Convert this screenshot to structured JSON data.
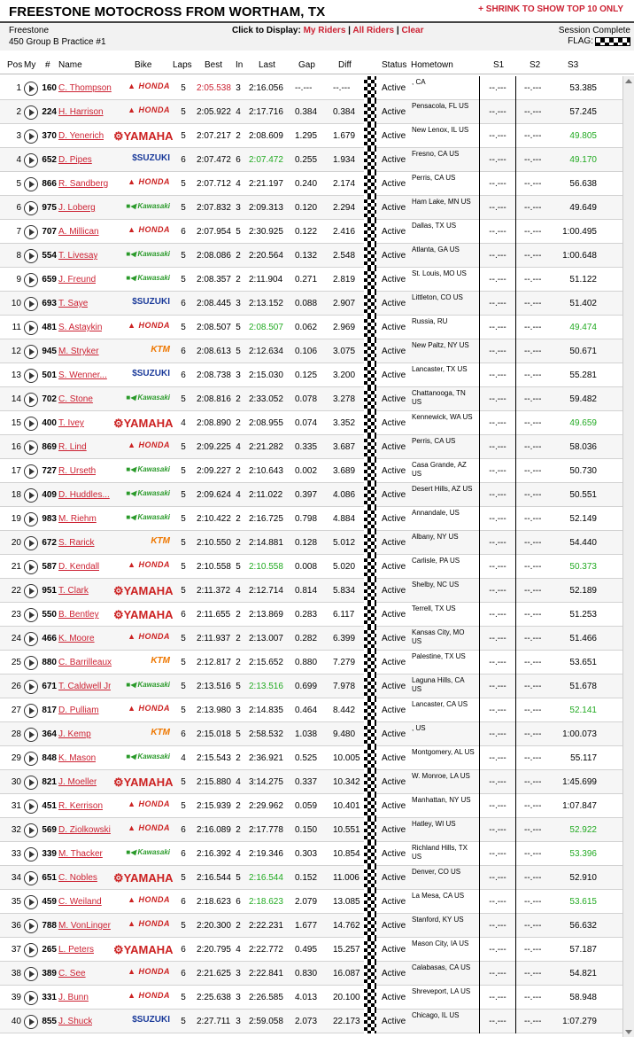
{
  "header": {
    "title": "FREESTONE MOTOCROSS FROM WORTHAM, TX",
    "shrink_link": "+ SHRINK TO SHOW TOP 10 ONLY",
    "track": "Freestone",
    "session": "450 Group B Practice #1",
    "display_label": "Click to Display:",
    "my_riders": "My Riders",
    "all_riders": "All Riders",
    "clear": "Clear",
    "sep": "|",
    "status": "Session Complete",
    "flag_label": "FLAG:"
  },
  "columns": {
    "pos": "Pos",
    "my": "My",
    "num": "#",
    "name": "Name",
    "bike": "Bike",
    "laps": "Laps",
    "best": "Best",
    "in": "In",
    "last": "Last",
    "gap": "Gap",
    "diff": "Diff",
    "status": "Status",
    "hometown": "Hometown",
    "s1": "S1",
    "s2": "S2",
    "s3": "S3"
  },
  "bike_labels": {
    "honda": "HONDA",
    "yamaha": "YAMAHA",
    "suzuki": "SUZUKI",
    "kawasaki": "Kawasaki",
    "ktm": "KTM"
  },
  "colors": {
    "accent_red": "#cc2233",
    "best_green": "#22aa22"
  },
  "riders": [
    {
      "pos": "1",
      "num": "160",
      "name": "C. Thompson",
      "bike": "honda",
      "laps": "5",
      "best": "2:05.538",
      "best_overall": true,
      "in": "3",
      "last": "2:16.056",
      "last_is_best": false,
      "gap": "--.---",
      "diff": "--.---",
      "status": "Active",
      "hometown": ", CA",
      "s1": "--.---",
      "s2": "--.---",
      "s3": "53.385",
      "s3_best": false
    },
    {
      "pos": "2",
      "num": "224",
      "name": "H. Harrison",
      "bike": "honda",
      "laps": "5",
      "best": "2:05.922",
      "best_overall": false,
      "in": "4",
      "last": "2:17.716",
      "last_is_best": false,
      "gap": "0.384",
      "diff": "0.384",
      "status": "Active",
      "hometown": "Pensacola, FL US",
      "s1": "--.---",
      "s2": "--.---",
      "s3": "57.245",
      "s3_best": false
    },
    {
      "pos": "3",
      "num": "370",
      "name": "D. Yenerich",
      "bike": "yamaha",
      "laps": "5",
      "best": "2:07.217",
      "best_overall": false,
      "in": "2",
      "last": "2:08.609",
      "last_is_best": false,
      "gap": "1.295",
      "diff": "1.679",
      "status": "Active",
      "hometown": "New Lenox, IL US",
      "s1": "--.---",
      "s2": "--.---",
      "s3": "49.805",
      "s3_best": true
    },
    {
      "pos": "4",
      "num": "652",
      "name": "D. Pipes",
      "bike": "suzuki",
      "laps": "6",
      "best": "2:07.472",
      "best_overall": false,
      "in": "6",
      "last": "2:07.472",
      "last_is_best": true,
      "gap": "0.255",
      "diff": "1.934",
      "status": "Active",
      "hometown": "Fresno, CA US",
      "s1": "--.---",
      "s2": "--.---",
      "s3": "49.170",
      "s3_best": true
    },
    {
      "pos": "5",
      "num": "866",
      "name": "R. Sandberg",
      "bike": "honda",
      "laps": "5",
      "best": "2:07.712",
      "best_overall": false,
      "in": "4",
      "last": "2:21.197",
      "last_is_best": false,
      "gap": "0.240",
      "diff": "2.174",
      "status": "Active",
      "hometown": "Perris, CA US",
      "s1": "--.---",
      "s2": "--.---",
      "s3": "56.638",
      "s3_best": false
    },
    {
      "pos": "6",
      "num": "975",
      "name": "J. Loberg",
      "bike": "kawasaki",
      "laps": "5",
      "best": "2:07.832",
      "best_overall": false,
      "in": "3",
      "last": "2:09.313",
      "last_is_best": false,
      "gap": "0.120",
      "diff": "2.294",
      "status": "Active",
      "hometown": "Ham Lake, MN US",
      "s1": "--.---",
      "s2": "--.---",
      "s3": "49.649",
      "s3_best": false
    },
    {
      "pos": "7",
      "num": "707",
      "name": "A. Millican",
      "bike": "honda",
      "laps": "6",
      "best": "2:07.954",
      "best_overall": false,
      "in": "5",
      "last": "2:30.925",
      "last_is_best": false,
      "gap": "0.122",
      "diff": "2.416",
      "status": "Active",
      "hometown": "Dallas, TX US",
      "s1": "--.---",
      "s2": "--.---",
      "s3": "1:00.495",
      "s3_best": false
    },
    {
      "pos": "8",
      "num": "554",
      "name": "T. Livesay",
      "bike": "kawasaki",
      "laps": "5",
      "best": "2:08.086",
      "best_overall": false,
      "in": "2",
      "last": "2:20.564",
      "last_is_best": false,
      "gap": "0.132",
      "diff": "2.548",
      "status": "Active",
      "hometown": "Atlanta, GA US",
      "s1": "--.---",
      "s2": "--.---",
      "s3": "1:00.648",
      "s3_best": false
    },
    {
      "pos": "9",
      "num": "659",
      "name": "J. Freund",
      "bike": "kawasaki",
      "laps": "5",
      "best": "2:08.357",
      "best_overall": false,
      "in": "2",
      "last": "2:11.904",
      "last_is_best": false,
      "gap": "0.271",
      "diff": "2.819",
      "status": "Active",
      "hometown": "St. Louis, MO US",
      "s1": "--.---",
      "s2": "--.---",
      "s3": "51.122",
      "s3_best": false
    },
    {
      "pos": "10",
      "num": "693",
      "name": "T. Saye",
      "bike": "suzuki",
      "laps": "6",
      "best": "2:08.445",
      "best_overall": false,
      "in": "3",
      "last": "2:13.152",
      "last_is_best": false,
      "gap": "0.088",
      "diff": "2.907",
      "status": "Active",
      "hometown": "Littleton, CO US",
      "s1": "--.---",
      "s2": "--.---",
      "s3": "51.402",
      "s3_best": false
    },
    {
      "pos": "11",
      "num": "481",
      "name": "S. Astaykin",
      "bike": "honda",
      "laps": "5",
      "best": "2:08.507",
      "best_overall": false,
      "in": "5",
      "last": "2:08.507",
      "last_is_best": true,
      "gap": "0.062",
      "diff": "2.969",
      "status": "Active",
      "hometown": "Russia, RU",
      "s1": "--.---",
      "s2": "--.---",
      "s3": "49.474",
      "s3_best": true
    },
    {
      "pos": "12",
      "num": "945",
      "name": "M. Stryker",
      "bike": "ktm",
      "laps": "6",
      "best": "2:08.613",
      "best_overall": false,
      "in": "5",
      "last": "2:12.634",
      "last_is_best": false,
      "gap": "0.106",
      "diff": "3.075",
      "status": "Active",
      "hometown": "New Paltz, NY US",
      "s1": "--.---",
      "s2": "--.---",
      "s3": "50.671",
      "s3_best": false
    },
    {
      "pos": "13",
      "num": "501",
      "name": "S. Wenner...",
      "bike": "suzuki",
      "laps": "6",
      "best": "2:08.738",
      "best_overall": false,
      "in": "3",
      "last": "2:15.030",
      "last_is_best": false,
      "gap": "0.125",
      "diff": "3.200",
      "status": "Active",
      "hometown": "Lancaster, TX US",
      "s1": "--.---",
      "s2": "--.---",
      "s3": "55.281",
      "s3_best": false
    },
    {
      "pos": "14",
      "num": "702",
      "name": "C. Stone",
      "bike": "kawasaki",
      "laps": "5",
      "best": "2:08.816",
      "best_overall": false,
      "in": "2",
      "last": "2:33.052",
      "last_is_best": false,
      "gap": "0.078",
      "diff": "3.278",
      "status": "Active",
      "hometown": "Chattanooga, TN US",
      "s1": "--.---",
      "s2": "--.---",
      "s3": "59.482",
      "s3_best": false
    },
    {
      "pos": "15",
      "num": "400",
      "name": "T. Ivey",
      "bike": "yamaha",
      "laps": "4",
      "best": "2:08.890",
      "best_overall": false,
      "in": "2",
      "last": "2:08.955",
      "last_is_best": false,
      "gap": "0.074",
      "diff": "3.352",
      "status": "Active",
      "hometown": "Kennewick, WA US",
      "s1": "--.---",
      "s2": "--.---",
      "s3": "49.659",
      "s3_best": true
    },
    {
      "pos": "16",
      "num": "869",
      "name": "R. Lind",
      "bike": "honda",
      "laps": "5",
      "best": "2:09.225",
      "best_overall": false,
      "in": "4",
      "last": "2:21.282",
      "last_is_best": false,
      "gap": "0.335",
      "diff": "3.687",
      "status": "Active",
      "hometown": "Perris, CA US",
      "s1": "--.---",
      "s2": "--.---",
      "s3": "58.036",
      "s3_best": false
    },
    {
      "pos": "17",
      "num": "727",
      "name": "R. Urseth",
      "bike": "kawasaki",
      "laps": "5",
      "best": "2:09.227",
      "best_overall": false,
      "in": "2",
      "last": "2:10.643",
      "last_is_best": false,
      "gap": "0.002",
      "diff": "3.689",
      "status": "Active",
      "hometown": "Casa Grande, AZ US",
      "s1": "--.---",
      "s2": "--.---",
      "s3": "50.730",
      "s3_best": false
    },
    {
      "pos": "18",
      "num": "409",
      "name": "D. Huddles...",
      "bike": "kawasaki",
      "laps": "5",
      "best": "2:09.624",
      "best_overall": false,
      "in": "4",
      "last": "2:11.022",
      "last_is_best": false,
      "gap": "0.397",
      "diff": "4.086",
      "status": "Active",
      "hometown": "Desert Hills, AZ US",
      "s1": "--.---",
      "s2": "--.---",
      "s3": "50.551",
      "s3_best": false
    },
    {
      "pos": "19",
      "num": "983",
      "name": "M. Riehm",
      "bike": "kawasaki",
      "laps": "5",
      "best": "2:10.422",
      "best_overall": false,
      "in": "2",
      "last": "2:16.725",
      "last_is_best": false,
      "gap": "0.798",
      "diff": "4.884",
      "status": "Active",
      "hometown": "Annandale, US",
      "s1": "--.---",
      "s2": "--.---",
      "s3": "52.149",
      "s3_best": false
    },
    {
      "pos": "20",
      "num": "672",
      "name": "S. Rarick",
      "bike": "ktm",
      "laps": "5",
      "best": "2:10.550",
      "best_overall": false,
      "in": "2",
      "last": "2:14.881",
      "last_is_best": false,
      "gap": "0.128",
      "diff": "5.012",
      "status": "Active",
      "hometown": "Albany, NY US",
      "s1": "--.---",
      "s2": "--.---",
      "s3": "54.440",
      "s3_best": false
    },
    {
      "pos": "21",
      "num": "587",
      "name": "D. Kendall",
      "bike": "honda",
      "laps": "5",
      "best": "2:10.558",
      "best_overall": false,
      "in": "5",
      "last": "2:10.558",
      "last_is_best": true,
      "gap": "0.008",
      "diff": "5.020",
      "status": "Active",
      "hometown": "Carlisle, PA US",
      "s1": "--.---",
      "s2": "--.---",
      "s3": "50.373",
      "s3_best": true
    },
    {
      "pos": "22",
      "num": "951",
      "name": "T. Clark",
      "bike": "yamaha",
      "laps": "5",
      "best": "2:11.372",
      "best_overall": false,
      "in": "4",
      "last": "2:12.714",
      "last_is_best": false,
      "gap": "0.814",
      "diff": "5.834",
      "status": "Active",
      "hometown": "Shelby, NC US",
      "s1": "--.---",
      "s2": "--.---",
      "s3": "52.189",
      "s3_best": false
    },
    {
      "pos": "23",
      "num": "550",
      "name": "B. Bentley",
      "bike": "yamaha",
      "laps": "6",
      "best": "2:11.655",
      "best_overall": false,
      "in": "2",
      "last": "2:13.869",
      "last_is_best": false,
      "gap": "0.283",
      "diff": "6.117",
      "status": "Active",
      "hometown": "Terrell, TX US",
      "s1": "--.---",
      "s2": "--.---",
      "s3": "51.253",
      "s3_best": false
    },
    {
      "pos": "24",
      "num": "466",
      "name": "K. Moore",
      "bike": "honda",
      "laps": "5",
      "best": "2:11.937",
      "best_overall": false,
      "in": "2",
      "last": "2:13.007",
      "last_is_best": false,
      "gap": "0.282",
      "diff": "6.399",
      "status": "Active",
      "hometown": "Kansas City, MO US",
      "s1": "--.---",
      "s2": "--.---",
      "s3": "51.466",
      "s3_best": false
    },
    {
      "pos": "25",
      "num": "880",
      "name": "C. Barrilleaux",
      "bike": "ktm",
      "laps": "5",
      "best": "2:12.817",
      "best_overall": false,
      "in": "2",
      "last": "2:15.652",
      "last_is_best": false,
      "gap": "0.880",
      "diff": "7.279",
      "status": "Active",
      "hometown": "Palestine, TX US",
      "s1": "--.---",
      "s2": "--.---",
      "s3": "53.651",
      "s3_best": false
    },
    {
      "pos": "26",
      "num": "671",
      "name": "T. Caldwell Jr",
      "bike": "kawasaki",
      "laps": "5",
      "best": "2:13.516",
      "best_overall": false,
      "in": "5",
      "last": "2:13.516",
      "last_is_best": true,
      "gap": "0.699",
      "diff": "7.978",
      "status": "Active",
      "hometown": "Laguna Hills, CA US",
      "s1": "--.---",
      "s2": "--.---",
      "s3": "51.678",
      "s3_best": false
    },
    {
      "pos": "27",
      "num": "817",
      "name": "D. Pulliam",
      "bike": "honda",
      "laps": "5",
      "best": "2:13.980",
      "best_overall": false,
      "in": "3",
      "last": "2:14.835",
      "last_is_best": false,
      "gap": "0.464",
      "diff": "8.442",
      "status": "Active",
      "hometown": "Lancaster, CA US",
      "s1": "--.---",
      "s2": "--.---",
      "s3": "52.141",
      "s3_best": true
    },
    {
      "pos": "28",
      "num": "364",
      "name": "J. Kemp",
      "bike": "ktm",
      "laps": "6",
      "best": "2:15.018",
      "best_overall": false,
      "in": "5",
      "last": "2:58.532",
      "last_is_best": false,
      "gap": "1.038",
      "diff": "9.480",
      "status": "Active",
      "hometown": ", US",
      "s1": "--.---",
      "s2": "--.---",
      "s3": "1:00.073",
      "s3_best": false
    },
    {
      "pos": "29",
      "num": "848",
      "name": "K. Mason",
      "bike": "kawasaki",
      "laps": "4",
      "best": "2:15.543",
      "best_overall": false,
      "in": "2",
      "last": "2:36.921",
      "last_is_best": false,
      "gap": "0.525",
      "diff": "10.005",
      "status": "Active",
      "hometown": "Montgomery, AL US",
      "s1": "--.---",
      "s2": "--.---",
      "s3": "55.117",
      "s3_best": false
    },
    {
      "pos": "30",
      "num": "821",
      "name": "J. Moeller",
      "bike": "yamaha",
      "laps": "5",
      "best": "2:15.880",
      "best_overall": false,
      "in": "4",
      "last": "3:14.275",
      "last_is_best": false,
      "gap": "0.337",
      "diff": "10.342",
      "status": "Active",
      "hometown": "W. Monroe, LA US",
      "s1": "--.---",
      "s2": "--.---",
      "s3": "1:45.699",
      "s3_best": false
    },
    {
      "pos": "31",
      "num": "451",
      "name": "R. Kerrison",
      "bike": "honda",
      "laps": "5",
      "best": "2:15.939",
      "best_overall": false,
      "in": "2",
      "last": "2:29.962",
      "last_is_best": false,
      "gap": "0.059",
      "diff": "10.401",
      "status": "Active",
      "hometown": "Manhattan, NY US",
      "s1": "--.---",
      "s2": "--.---",
      "s3": "1:07.847",
      "s3_best": false
    },
    {
      "pos": "32",
      "num": "569",
      "name": "D. Ziolkowski",
      "bike": "honda",
      "laps": "6",
      "best": "2:16.089",
      "best_overall": false,
      "in": "2",
      "last": "2:17.778",
      "last_is_best": false,
      "gap": "0.150",
      "diff": "10.551",
      "status": "Active",
      "hometown": "Hatley, WI US",
      "s1": "--.---",
      "s2": "--.---",
      "s3": "52.922",
      "s3_best": true
    },
    {
      "pos": "33",
      "num": "339",
      "name": "M. Thacker",
      "bike": "kawasaki",
      "laps": "6",
      "best": "2:16.392",
      "best_overall": false,
      "in": "4",
      "last": "2:19.346",
      "last_is_best": false,
      "gap": "0.303",
      "diff": "10.854",
      "status": "Active",
      "hometown": "Richland Hills, TX US",
      "s1": "--.---",
      "s2": "--.---",
      "s3": "53.396",
      "s3_best": true
    },
    {
      "pos": "34",
      "num": "651",
      "name": "C. Nobles",
      "bike": "yamaha",
      "laps": "5",
      "best": "2:16.544",
      "best_overall": false,
      "in": "5",
      "last": "2:16.544",
      "last_is_best": true,
      "gap": "0.152",
      "diff": "11.006",
      "status": "Active",
      "hometown": "Denver, CO US",
      "s1": "--.---",
      "s2": "--.---",
      "s3": "52.910",
      "s3_best": false
    },
    {
      "pos": "35",
      "num": "459",
      "name": "C. Weiland",
      "bike": "honda",
      "laps": "6",
      "best": "2:18.623",
      "best_overall": false,
      "in": "6",
      "last": "2:18.623",
      "last_is_best": true,
      "gap": "2.079",
      "diff": "13.085",
      "status": "Active",
      "hometown": "La Mesa, CA US",
      "s1": "--.---",
      "s2": "--.---",
      "s3": "53.615",
      "s3_best": true
    },
    {
      "pos": "36",
      "num": "788",
      "name": "M. VonLinger",
      "bike": "honda",
      "laps": "5",
      "best": "2:20.300",
      "best_overall": false,
      "in": "2",
      "last": "2:22.231",
      "last_is_best": false,
      "gap": "1.677",
      "diff": "14.762",
      "status": "Active",
      "hometown": "Stanford, KY US",
      "s1": "--.---",
      "s2": "--.---",
      "s3": "56.632",
      "s3_best": false
    },
    {
      "pos": "37",
      "num": "265",
      "name": "L. Peters",
      "bike": "yamaha",
      "laps": "6",
      "best": "2:20.795",
      "best_overall": false,
      "in": "4",
      "last": "2:22.772",
      "last_is_best": false,
      "gap": "0.495",
      "diff": "15.257",
      "status": "Active",
      "hometown": "Mason City, IA US",
      "s1": "--.---",
      "s2": "--.---",
      "s3": "57.187",
      "s3_best": false
    },
    {
      "pos": "38",
      "num": "389",
      "name": "C. See",
      "bike": "honda",
      "laps": "6",
      "best": "2:21.625",
      "best_overall": false,
      "in": "3",
      "last": "2:22.841",
      "last_is_best": false,
      "gap": "0.830",
      "diff": "16.087",
      "status": "Active",
      "hometown": "Calabasas, CA US",
      "s1": "--.---",
      "s2": "--.---",
      "s3": "54.821",
      "s3_best": false
    },
    {
      "pos": "39",
      "num": "331",
      "name": "J. Bunn",
      "bike": "honda",
      "laps": "5",
      "best": "2:25.638",
      "best_overall": false,
      "in": "3",
      "last": "2:26.585",
      "last_is_best": false,
      "gap": "4.013",
      "diff": "20.100",
      "status": "Active",
      "hometown": "Shreveport, LA US",
      "s1": "--.---",
      "s2": "--.---",
      "s3": "58.948",
      "s3_best": false
    },
    {
      "pos": "40",
      "num": "855",
      "name": "J. Shuck",
      "bike": "suzuki",
      "laps": "5",
      "best": "2:27.711",
      "best_overall": false,
      "in": "3",
      "last": "2:59.058",
      "last_is_best": false,
      "gap": "2.073",
      "diff": "22.173",
      "status": "Active",
      "hometown": "Chicago, IL US",
      "s1": "--.---",
      "s2": "--.---",
      "s3": "1:07.279",
      "s3_best": false
    }
  ]
}
